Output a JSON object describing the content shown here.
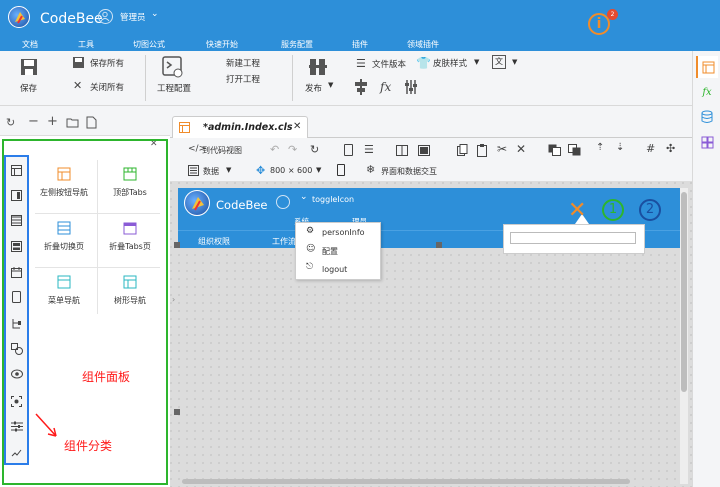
{
  "app": {
    "brand": "CodeBee",
    "user": "管理员",
    "notification_count": "2"
  },
  "menu": [
    "文档",
    "工具",
    "切图公式",
    "快速开始",
    "服务配置",
    "插件",
    "领域插件"
  ],
  "ribbon": {
    "save": "保存",
    "save_all": "保存所有",
    "close_all": "关闭所有",
    "project_config": "工程配置",
    "new_project": "新建工程",
    "open_project": "打开工程",
    "publish": "发布",
    "file_version": "文件版本",
    "skin_style": "皮肤样式"
  },
  "editor": {
    "tab_title": "*admin.Index.cls",
    "to_code_view": "到代码视图",
    "data": "数据",
    "size": "800 × 600",
    "interface_data": "界面和数据交互"
  },
  "components": {
    "panel_title": "组件面板",
    "category_title": "组件分类",
    "items": [
      {
        "label": "左侧按钮导航"
      },
      {
        "label": "顶部Tabs"
      },
      {
        "label": "折叠切换页"
      },
      {
        "label": "折叠Tabs页"
      },
      {
        "label": "菜单导航"
      },
      {
        "label": "树形导航"
      }
    ]
  },
  "preview": {
    "brand": "CodeBee",
    "toggle": "toggleIcon",
    "menu_items": [
      "personInfo",
      "配置",
      "logout"
    ],
    "nav_items": [
      "组织权限",
      "工作流"
    ],
    "system_text": "系统",
    "admin_text": "理员",
    "circle1": "1",
    "circle2": "2"
  },
  "colors": {
    "accent": "#2d8fd9",
    "green": "#2db52d",
    "blue_box": "#2b7de9",
    "annotation": "#ff1a1a",
    "orange": "#f08c2b"
  }
}
